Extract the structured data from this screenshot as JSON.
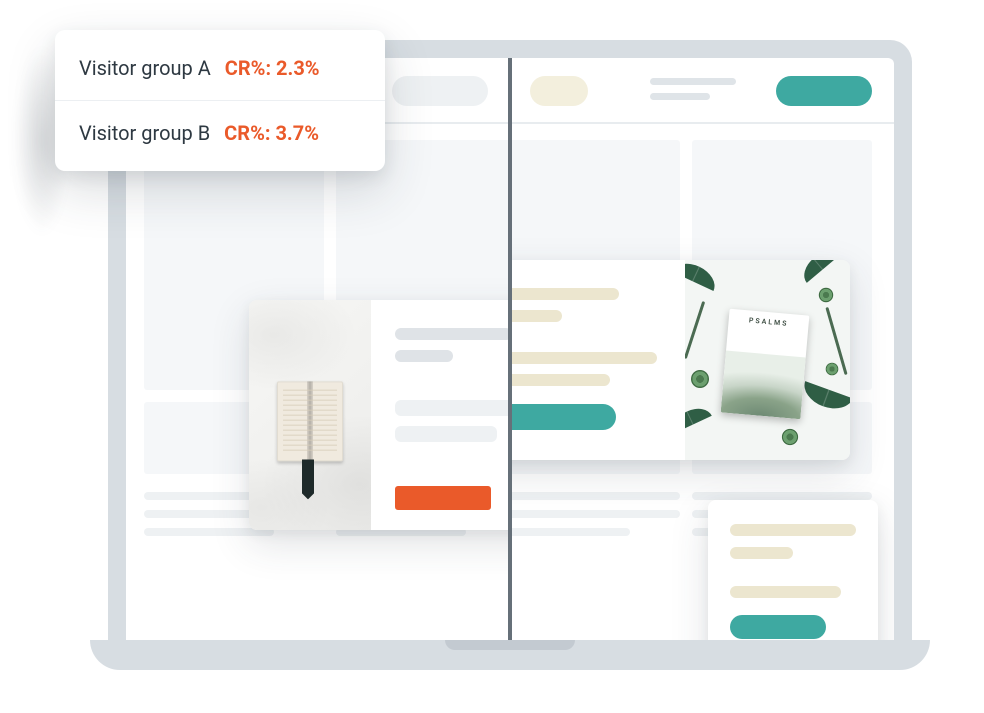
{
  "metrics": {
    "group_a": {
      "label": "Visitor group A",
      "metric": "CR%: 2.3%"
    },
    "group_b": {
      "label": "Visitor group B",
      "metric": "CR%: 3.7%"
    }
  },
  "variant_b_image": {
    "booklet_title": "PSALMS"
  },
  "colors": {
    "accent_orange": "#ea5a2a",
    "accent_teal": "#3ea9a1",
    "beige": "#ece6cf",
    "frame_grey": "#d7dde2",
    "divider": "#667079"
  }
}
